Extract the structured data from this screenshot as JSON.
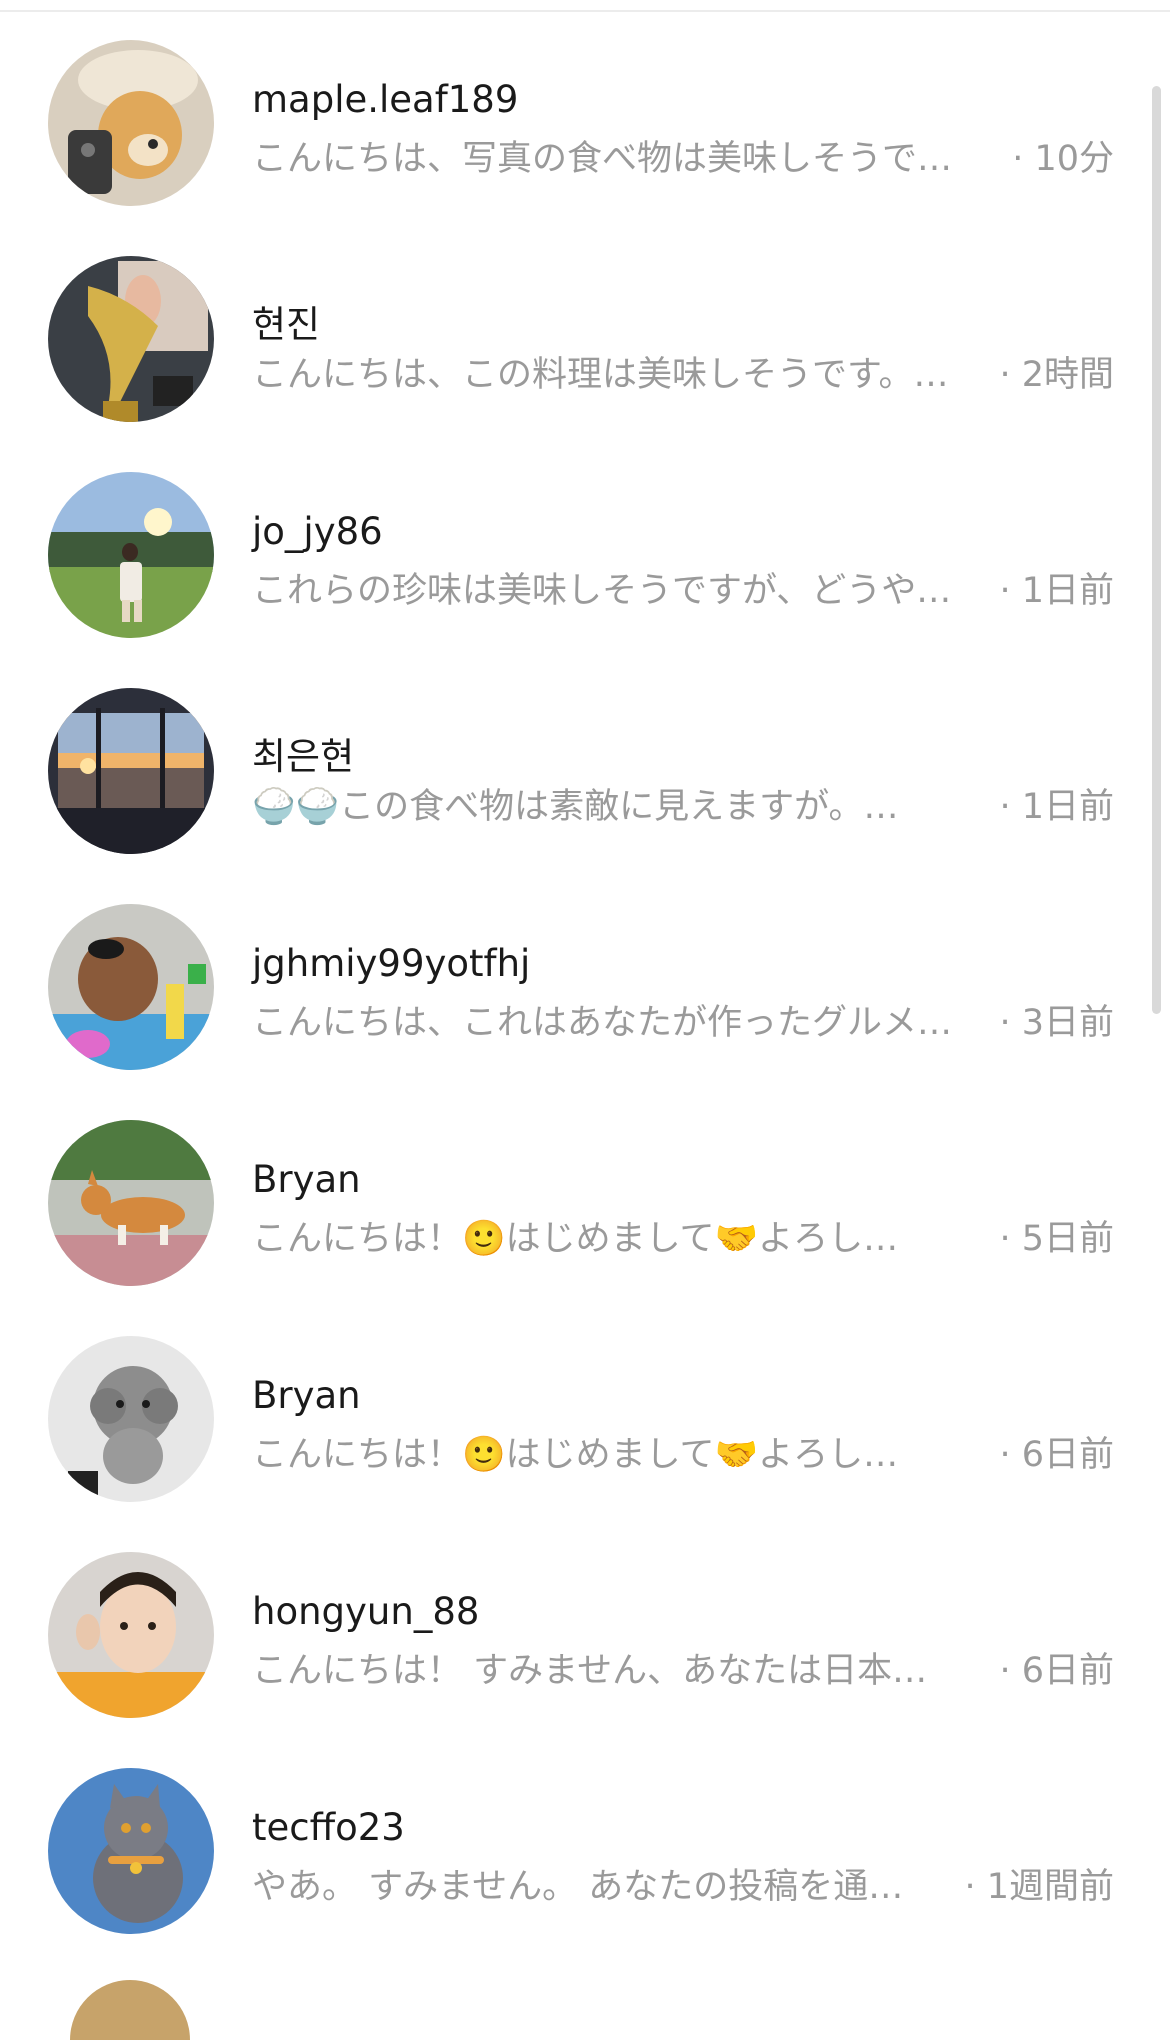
{
  "conversations": [
    {
      "username": "maple.leaf189",
      "preview": "こんにちは、写真の食べ物は美味しそうで…",
      "time": "· 10分",
      "avatar": "dog-with-phone-avatar"
    },
    {
      "username": "현진",
      "preview": "こんにちは、この料理は美味しそうです。…",
      "time": "· 2時間",
      "avatar": "trophy-selfie-avatar"
    },
    {
      "username": "jo_jy86",
      "preview": "これらの珍味は美味しそうですが、どうや…",
      "time": "· 1日前",
      "avatar": "man-in-garden-avatar"
    },
    {
      "username": "최은현",
      "preview": "🍚🍚この食べ物は素敵に見えますが。…",
      "time": "· 1日前",
      "avatar": "sunset-window-avatar"
    },
    {
      "username": "jghmiy99yotfhj",
      "preview": "こんにちは、これはあなたが作ったグルメ…",
      "time": "· 3日前",
      "avatar": "brown-dog-toys-avatar"
    },
    {
      "username": "Bryan",
      "preview": "こんにちは！🙂はじめまして🤝よろし…",
      "time": "· 5日前",
      "avatar": "corgi-avatar"
    },
    {
      "username": "Bryan",
      "preview": "こんにちは！🙂はじめまして🤝よろし…",
      "time": "· 6日前",
      "avatar": "grey-poodle-avatar"
    },
    {
      "username": "hongyun_88",
      "preview": "こんにちは！ すみません、あなたは日本…",
      "time": "· 6日前",
      "avatar": "man-portrait-avatar"
    },
    {
      "username": "tecffo23",
      "preview": "やあ。 すみません。 あなたの投稿を通…",
      "time": "· 1週間前",
      "avatar": "grey-cat-avatar"
    }
  ],
  "colors": {
    "username": "#1a1a1a",
    "secondary_text": "#9a9a9a",
    "scrollbar": "#d9d9d9"
  }
}
